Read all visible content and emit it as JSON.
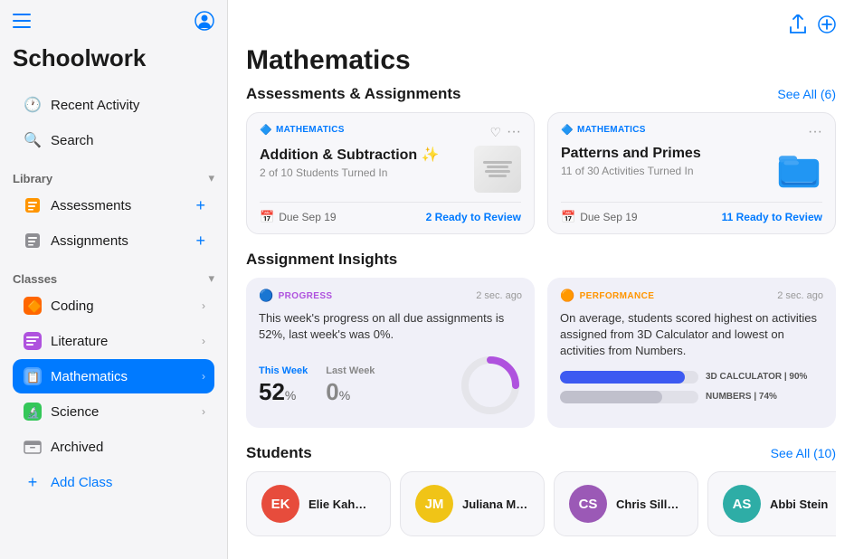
{
  "app": {
    "title": "Schoolwork"
  },
  "sidebar": {
    "title": "Schoolwork",
    "recent_activity_label": "Recent Activity",
    "search_label": "Search",
    "library_label": "Library",
    "assessments_label": "Assessments",
    "assignments_label": "Assignments",
    "classes_label": "Classes",
    "class_items": [
      {
        "id": "coding",
        "label": "Coding",
        "icon": "🟠"
      },
      {
        "id": "literature",
        "label": "Literature",
        "icon": "📊"
      },
      {
        "id": "mathematics",
        "label": "Mathematics",
        "icon": "📋",
        "active": true
      },
      {
        "id": "science",
        "label": "Science",
        "icon": "🔬"
      }
    ],
    "archived_label": "Archived",
    "add_class_label": "Add Class"
  },
  "main": {
    "page_title": "Mathematics",
    "assessments_section": {
      "title": "Assessments & Assignments",
      "see_all_label": "See All (6)",
      "cards": [
        {
          "subject_tag": "MATHEMATICS",
          "title": "Addition & Subtraction ✨",
          "subtitle": "2 of 10 Students Turned In",
          "due": "Due Sep 19",
          "ready": "2 Ready to Review",
          "has_heart": true
        },
        {
          "subject_tag": "MATHEMATICS",
          "title": "Patterns and Primes",
          "subtitle": "11 of 30 Activities Turned In",
          "due": "Due Sep 19",
          "ready": "11 Ready to Review",
          "has_heart": false
        }
      ]
    },
    "insights_section": {
      "title": "Assignment Insights",
      "progress_card": {
        "tag": "PROGRESS",
        "time": "2 sec. ago",
        "text": "This week's progress on all due assignments is 52%, last week's was 0%.",
        "this_week_label": "This Week",
        "last_week_label": "Last Week",
        "this_week_value": "52",
        "last_week_value": "0",
        "suffix": "%"
      },
      "performance_card": {
        "tag": "PERFORMANCE",
        "time": "2 sec. ago",
        "text": "On average, students scored highest on activities assigned from 3D Calculator and lowest on activities from Numbers.",
        "bar1_label": "3D CALCULATOR | 90%",
        "bar1_pct": 90,
        "bar2_label": "NUMBERS | 74%",
        "bar2_pct": 74
      }
    },
    "students_section": {
      "title": "Students",
      "see_all_label": "See All (10)",
      "students": [
        {
          "initials": "EK",
          "name": "Elie Kahwagi",
          "color": "#e74c3c"
        },
        {
          "initials": "JM",
          "name": "Juliana Mejia",
          "color": "#f0c417"
        },
        {
          "initials": "CS",
          "name": "Chris Sillers",
          "color": "#9b59b6"
        },
        {
          "initials": "AS",
          "name": "Abbi Stein",
          "color": "#2eada6",
          "partial": true
        }
      ]
    }
  }
}
